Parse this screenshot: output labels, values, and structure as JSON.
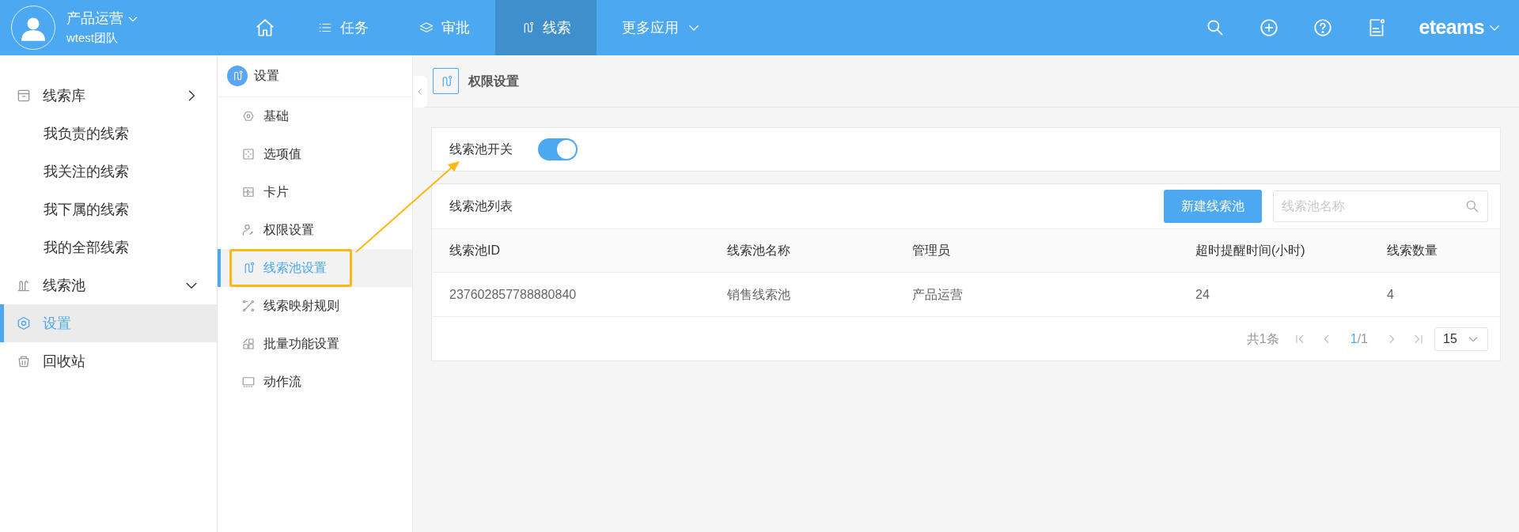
{
  "user": {
    "name": "产品运营",
    "team": "wtest团队"
  },
  "nav": [
    {
      "kind": "home",
      "selected": false
    },
    {
      "kind": "list",
      "label": "任务",
      "selected": false
    },
    {
      "kind": "layers",
      "label": "审批",
      "selected": false
    },
    {
      "kind": "route",
      "label": "线索",
      "selected": true
    },
    {
      "kind": "more",
      "label": "更多应用",
      "selected": false
    }
  ],
  "brand": "eteams",
  "sidebar": {
    "items": [
      {
        "kind": "box",
        "label": "线索库",
        "expanded": false,
        "selected": false,
        "children": [
          {
            "label": "我负责的线索"
          },
          {
            "label": "我关注的线索"
          },
          {
            "label": "我下属的线索"
          },
          {
            "label": "我的全部线索"
          }
        ]
      },
      {
        "kind": "pool",
        "label": "线索池",
        "expanded": true,
        "selected": false
      },
      {
        "kind": "gear",
        "label": "设置",
        "selected": true
      },
      {
        "kind": "trash",
        "label": "回收站",
        "selected": false
      }
    ]
  },
  "settings_menu": {
    "title": "设置",
    "items": [
      {
        "label": "基础",
        "selected": false
      },
      {
        "label": "选项值",
        "selected": false
      },
      {
        "label": "卡片",
        "selected": false
      },
      {
        "label": "权限设置",
        "selected": false
      },
      {
        "label": "线索池设置",
        "selected": true
      },
      {
        "label": "线索映射规则",
        "selected": false
      },
      {
        "label": "批量功能设置",
        "selected": false
      },
      {
        "label": "动作流",
        "selected": false
      }
    ]
  },
  "page_title": "权限设置",
  "pool_switch": {
    "label": "线索池开关",
    "on": true
  },
  "pool_list": {
    "title": "线索池列表",
    "new_button": "新建线索池",
    "search": {
      "placeholder": "线索池名称"
    },
    "columns": [
      "线索池ID",
      "线索池名称",
      "管理员",
      "超时提醒时间(小时)",
      "线索数量"
    ],
    "rows": [
      [
        "237602857788880840",
        "销售线索池",
        "产品运营",
        "24",
        "4"
      ]
    ],
    "pagination": {
      "total": "共1条",
      "page": "1",
      "of": "/1",
      "page_size": "15"
    }
  }
}
